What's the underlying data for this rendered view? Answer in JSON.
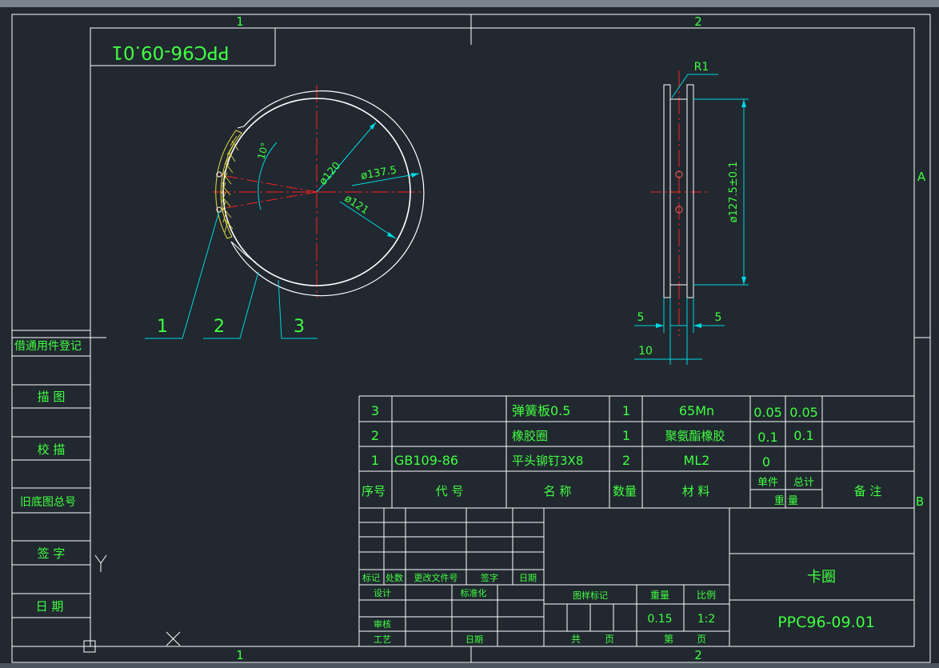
{
  "colors": {
    "background": "#212830",
    "frame": "#ffffff",
    "dim": "#00d8e0",
    "text": "#40ff40",
    "centerline": "#ff2020",
    "hatch": "#e8e040"
  },
  "title_block": {
    "top_mirror_code": "PPC96-09.01",
    "part_name": "卡圈",
    "drawing_number": "PPC96-09.01",
    "weight_label": "重量",
    "weight_value": "0.15",
    "scale_label": "比例",
    "scale_value": "1:2",
    "pattern_mark_label": "图样标记",
    "total_label": "共",
    "sheet_label": "第",
    "page_label": "页",
    "rev_headers": [
      "标记",
      "处数",
      "更改文件号",
      "签字",
      "日期"
    ],
    "design": "设计",
    "standard": "标准化",
    "review": "审核",
    "process": "工艺",
    "date": "日期"
  },
  "side_column": {
    "items": [
      "借通用件登记",
      "描 图",
      "校 描",
      "旧底图总号",
      "签 字",
      "日 期"
    ]
  },
  "zones": {
    "top": [
      "1",
      "2"
    ],
    "bottom": [
      "1",
      "2"
    ],
    "right": [
      "A",
      "B"
    ]
  },
  "bom": {
    "rows": [
      {
        "no": "3",
        "code": "",
        "name": "弹簧板0.5",
        "qty": "1",
        "material": "65Mn",
        "unit_weight": "0.05",
        "total_weight": "0.05",
        "note": ""
      },
      {
        "no": "2",
        "code": "",
        "name": "橡胶圈",
        "qty": "1",
        "material": "聚氨酯橡胶",
        "unit_weight": "0.1",
        "total_weight": "0.1",
        "note": ""
      },
      {
        "no": "1",
        "code": "GB109-86",
        "name": "平头铆钉3X8",
        "qty": "2",
        "material": "ML2",
        "unit_weight": "0",
        "total_weight": "",
        "note": ""
      }
    ],
    "headers": {
      "no": "序号",
      "code": "代 号",
      "name": "名 称",
      "qty": "数量",
      "material": "材 料",
      "unit": "单件",
      "total": "总计",
      "weight": "重 量",
      "note": "备 注"
    }
  },
  "dimensions": {
    "d120": "ø120",
    "d1375": "ø137.5",
    "d121": "ø121",
    "angle": "10°",
    "r1": "R1",
    "d1275": "ø127.5±0.1",
    "five_left": "5",
    "five_right": "5",
    "ten": "10"
  },
  "callouts": [
    "1",
    "2",
    "3"
  ]
}
